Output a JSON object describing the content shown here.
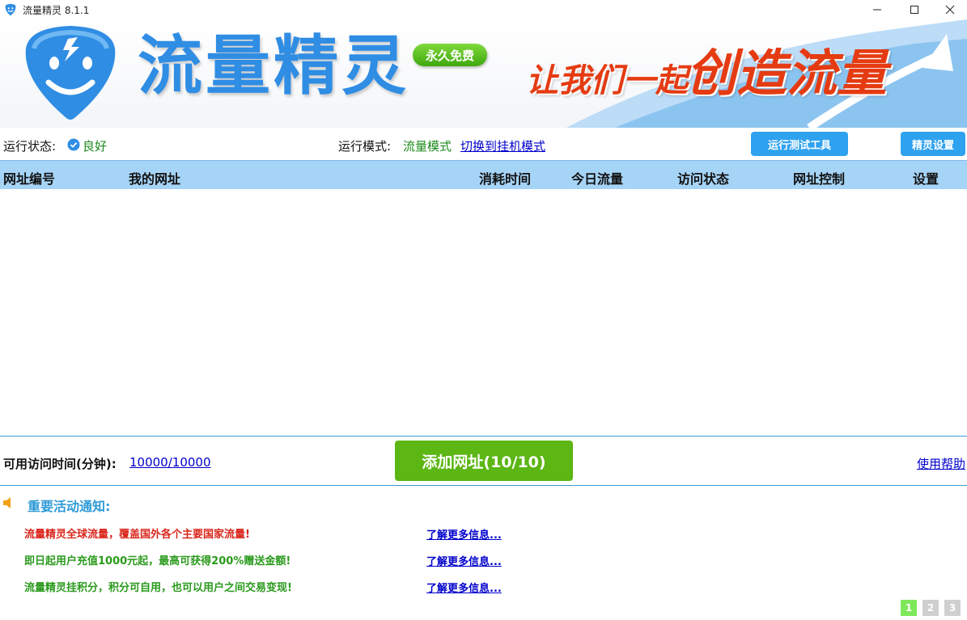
{
  "window": {
    "title": "流量精灵 8.1.1"
  },
  "banner": {
    "logo_text": "流量精灵",
    "badge": "永久免费",
    "slogan_small": "让我们一起",
    "slogan_big": "创造流量"
  },
  "status": {
    "run_label": "运行状态:",
    "run_value": "良好",
    "mode_label": "运行模式:",
    "mode_value": "流量模式",
    "mode_switch": "切换到挂机模式",
    "test_tool_button": "运行测试工具",
    "settings_button": "精灵设置"
  },
  "table": {
    "columns": [
      "网址编号",
      "我的网址",
      "消耗时间",
      "今日流量",
      "访问状态",
      "网址控制",
      "设置"
    ],
    "rows": []
  },
  "bottom": {
    "available_label": "可用访问时间(分钟):",
    "available_value": "10000/10000",
    "add_button": "添加网址(10/10)",
    "help_link": "使用帮助"
  },
  "notices": {
    "title": "重要活动通知:",
    "items": [
      {
        "text": "流量精灵全球流量，覆盖国外各个主要国家流量!",
        "more": "了解更多信息...",
        "color": "#d9261c"
      },
      {
        "text": "即日起用户充值1000元起，最高可获得200%赠送金额!",
        "more": "了解更多信息...",
        "color": "#2a9a1c"
      },
      {
        "text": "流量精灵挂积分，积分可自用，也可以用户之间交易变现!",
        "more": "了解更多信息...",
        "color": "#2a9a1c"
      }
    ]
  },
  "pager": {
    "pages": [
      "1",
      "2",
      "3"
    ],
    "active": "1",
    "active_color": "#7fe85a",
    "inactive_color": "#cfcfcf"
  },
  "colors": {
    "accent_blue": "#2fa2ef",
    "header_blue": "#a6d4f7",
    "add_green": "#5cb614",
    "logo_blue": "#2f8de4",
    "slogan_red": "#e53b12"
  }
}
